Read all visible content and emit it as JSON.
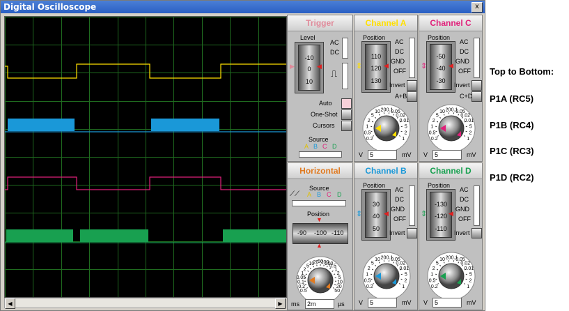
{
  "window": {
    "title": "Digital Oscilloscope",
    "close_glyph": "x"
  },
  "trigger": {
    "title": "Trigger",
    "title_color": "#e08a9a",
    "level_label": "Level",
    "level_ticks": [
      "-10",
      "0",
      "10"
    ],
    "coupling": [
      "AC",
      "DC"
    ],
    "buttons": [
      "Auto",
      "One-Shot",
      "Cursors"
    ],
    "source_label": "Source",
    "sources": [
      "A",
      "B",
      "C",
      "D"
    ]
  },
  "channels": [
    {
      "id": "A",
      "title": "Channel A",
      "color": "#ffe000",
      "position_label": "Position",
      "ticks": [
        "110",
        "120",
        "130"
      ],
      "coupling": [
        "AC",
        "DC",
        "GND",
        "OFF"
      ],
      "invert": "Invert",
      "extra": "A+B",
      "knob_left": "V",
      "knob_right": "mV",
      "value": "5",
      "scale": [
        "0.2",
        "0.5",
        "1",
        "2",
        "5",
        "10",
        "20",
        "0.1",
        "0.05",
        "0.02",
        "0.01",
        "5",
        "2",
        "1"
      ]
    },
    {
      "id": "C",
      "title": "Channel C",
      "color": "#e0207a",
      "position_label": "Position",
      "ticks": [
        "-50",
        "-40",
        "-30"
      ],
      "coupling": [
        "AC",
        "DC",
        "GND",
        "OFF"
      ],
      "invert": "Invert",
      "extra": "C+D",
      "knob_left": "V",
      "knob_right": "mV",
      "value": "5",
      "scale": [
        "0.2",
        "0.5",
        "1",
        "2",
        "5",
        "10",
        "20",
        "0.1",
        "0.05",
        "0.02",
        "0.01",
        "5",
        "2",
        "1"
      ]
    },
    {
      "id": "B",
      "title": "Channel B",
      "color": "#1a98d8",
      "position_label": "Position",
      "ticks": [
        "30",
        "40",
        "50"
      ],
      "coupling": [
        "AC",
        "DC",
        "GND",
        "OFF"
      ],
      "invert": "Invert",
      "extra": "",
      "knob_left": "V",
      "knob_right": "mV",
      "value": "5",
      "scale": [
        "0.2",
        "0.5",
        "1",
        "2",
        "5",
        "10",
        "20",
        "0.1",
        "0.05",
        "0.02",
        "0.01",
        "5",
        "2",
        "1"
      ]
    },
    {
      "id": "D",
      "title": "Channel D",
      "color": "#18a050",
      "position_label": "Position",
      "ticks": [
        "-130",
        "-120",
        "-110"
      ],
      "coupling": [
        "AC",
        "DC",
        "GND",
        "OFF"
      ],
      "invert": "Invert",
      "extra": "",
      "knob_left": "V",
      "knob_right": "mV",
      "value": "5",
      "scale": [
        "0.2",
        "0.5",
        "1",
        "2",
        "5",
        "10",
        "20",
        "0.1",
        "0.05",
        "0.02",
        "0.01",
        "5",
        "2",
        "1"
      ]
    }
  ],
  "horizontal": {
    "title": "Horizontal",
    "title_color": "#e07a20",
    "source_label": "Source",
    "sources": [
      "A",
      "B",
      "C",
      "D"
    ],
    "position_label": "Position",
    "ticks": [
      "-90",
      "-100",
      "-110"
    ],
    "knob_left": "ms",
    "knob_right": "µs",
    "value": "2m",
    "scale": [
      "0.5",
      "0.2",
      "0.1",
      "0.05",
      "1",
      "2",
      "5",
      "10",
      "20",
      "50",
      "100",
      "200",
      "0.5",
      "1",
      "2",
      "5",
      "10",
      "20",
      "50"
    ]
  },
  "trace_colors": {
    "a": "#ffe000",
    "b": "#1a98d8",
    "c": "#e0207a",
    "d": "#18a050",
    "grid": "#1f6b1f"
  },
  "notes": {
    "heading": "Top to Bottom:",
    "items": [
      "P1A (RC5)",
      "P1B (RC4)",
      "P1C (RC3)",
      "P1D (RC2)"
    ]
  }
}
